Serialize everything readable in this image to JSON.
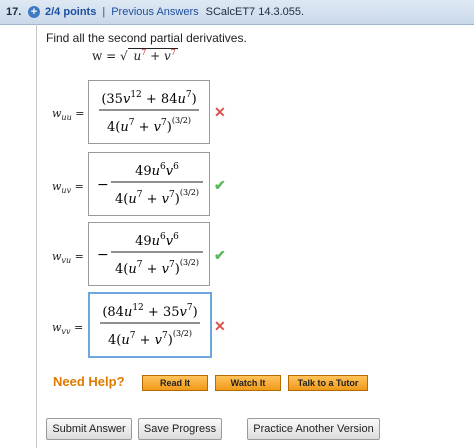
{
  "header": {
    "question_number": "17.",
    "points": "2/4 points",
    "separator": "|",
    "previous_answers": "Previous Answers",
    "reference": "SCalcET7 14.3.055."
  },
  "prompt": "Find all the second partial derivatives.",
  "function_def": {
    "lhs": "w =",
    "radicand_u": "u",
    "radicand_u_exp": "7",
    "radicand_plus": "+",
    "radicand_v": "v",
    "radicand_v_exp": "7"
  },
  "answers": [
    {
      "label_var": "w",
      "label_sub": "uu",
      "equals": "=",
      "numerator": "(35v¹² + 84u⁷)",
      "denominator": "4(u⁷ + v⁷)^(3/2)",
      "negative": false,
      "status": "incorrect"
    },
    {
      "label_var": "w",
      "label_sub": "uv",
      "equals": "=",
      "numerator": "49u⁶v⁶",
      "denominator": "4(u⁷ + v⁷)^(3/2)",
      "negative": true,
      "status": "correct"
    },
    {
      "label_var": "w",
      "label_sub": "vu",
      "equals": "=",
      "numerator": "49u⁶v⁶",
      "denominator": "4(u⁷ + v⁷)^(3/2)",
      "negative": true,
      "status": "correct"
    },
    {
      "label_var": "w",
      "label_sub": "vv",
      "equals": "=",
      "numerator": "(84u¹² + 35v⁷)",
      "denominator": "4(u⁷ + v⁷)^(3/2)",
      "negative": false,
      "status": "incorrect"
    }
  ],
  "need_help": {
    "label": "Need Help?",
    "buttons": [
      "Read It",
      "Watch It",
      "Talk to a Tutor"
    ]
  },
  "actions": {
    "submit": "Submit Answer",
    "save": "Save Progress",
    "practice": "Practice Another Version"
  },
  "colors": {
    "incorrect": "#d9534f",
    "correct": "#5cb85c",
    "help_text": "#e07b00",
    "link": "#1e4fa1"
  }
}
